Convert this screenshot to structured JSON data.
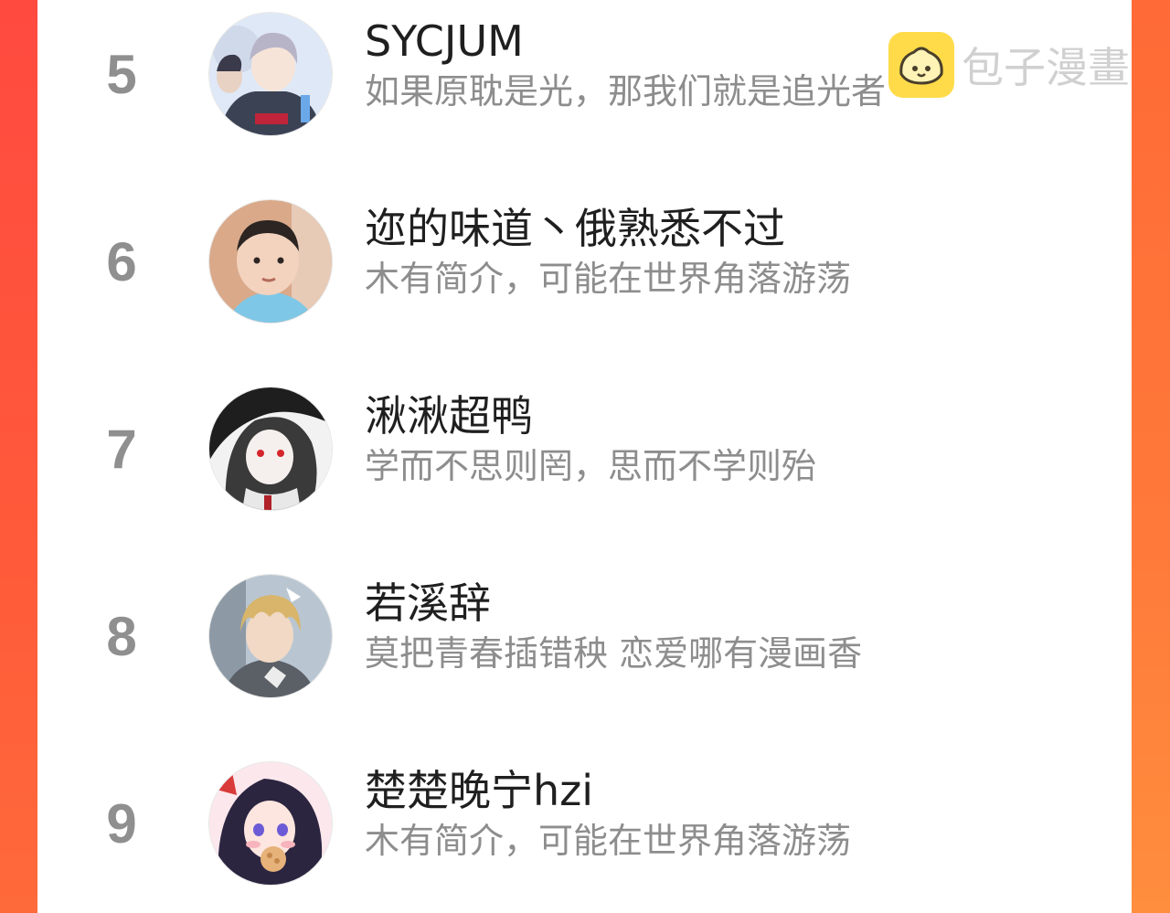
{
  "watermark": {
    "text": "包子漫畫",
    "logo_icon": "bun-logo-icon",
    "logo_color": "#ffd93a"
  },
  "colors": {
    "background_accent": "#ff5a3a",
    "rank_color": "#8f8f8f",
    "name_color": "#1f1f1f",
    "bio_color": "#8d8d8d"
  },
  "ranking": [
    {
      "rank": "5",
      "name": "SYCJUM",
      "bio": "如果原耽是光，那我们就是追光者"
    },
    {
      "rank": "6",
      "name": "迩的味道丶俄熟悉不过",
      "bio": "木有简介，可能在世界角落游荡"
    },
    {
      "rank": "7",
      "name": "湫湫超鸭",
      "bio": "学而不思则罔，思而不学则殆"
    },
    {
      "rank": "8",
      "name": "若溪辞",
      "bio": "莫把青春插错秧 恋爱哪有漫画香"
    },
    {
      "rank": "9",
      "name": "楚楚晚宁hzi",
      "bio": "木有简介，可能在世界角落游荡"
    }
  ]
}
